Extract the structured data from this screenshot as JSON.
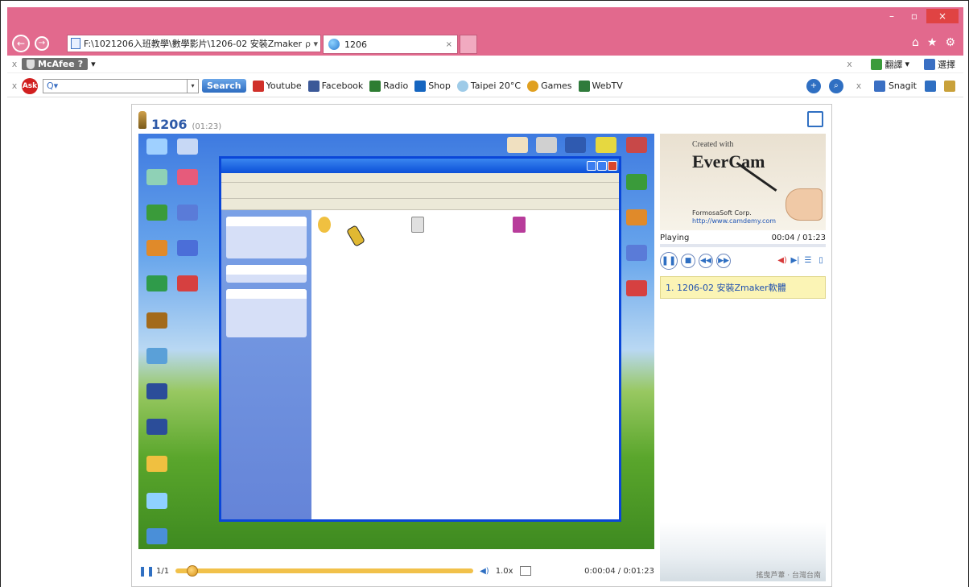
{
  "browser": {
    "address": "F:\\1021206入班教學\\數學影片\\1206-02 安裝Zmaker",
    "address_controls": "ρ ▾ C",
    "tab_title": "1206",
    "tab_close": "×",
    "win_min": "–",
    "win_max": "▫",
    "win_close": "×",
    "nav_back": "←",
    "nav_forward": "→",
    "home_icon": "⌂",
    "favorites_icon": "★",
    "settings_icon": "⚙"
  },
  "toolbar1": {
    "close": "x",
    "mcafee_label": "McAfee",
    "mcafee_help": "?",
    "mcafee_menu": "▾",
    "right_close": "x",
    "translate_label": "翻譯",
    "translate_menu": "▾",
    "select_label": "選擇"
  },
  "toolbar2": {
    "close": "x",
    "ask_label": "Ask",
    "search_placeholder": "Q▾",
    "dropdown": "▾",
    "search_button": "Search",
    "links": [
      {
        "label": "Youtube",
        "icon": "youtube-icon"
      },
      {
        "label": "Facebook",
        "icon": "facebook-icon"
      },
      {
        "label": "Radio",
        "icon": "radio-icon"
      },
      {
        "label": "Shop",
        "icon": "shop-icon"
      },
      {
        "label": "Taipei 20°C",
        "icon": "weather-icon"
      },
      {
        "label": "Games",
        "icon": "games-icon"
      },
      {
        "label": "WebTV",
        "icon": "tv-icon"
      }
    ],
    "right_close": "x",
    "snagit_label": "Snagit"
  },
  "player": {
    "title": "1206",
    "duration": "(01:23)",
    "page": "1/1",
    "speed": "1.0x",
    "time": "0:00:04 / 0:01:23",
    "pause_symbol": "❚❚",
    "volume_symbol": "◀)"
  },
  "sidebar": {
    "logo_created": "Created with",
    "logo_brand": "EverCam",
    "logo_corp": "FormosaSoft Corp.",
    "logo_url": "http://www.camdemy.com",
    "status": "Playing",
    "time": "00:04 / 01:23",
    "playlist_item": "1. 1206-02 安裝Zmaker軟體",
    "decor_caption": "搖曳芦葦 · 台灣台南",
    "ctl_pause": "❚❚",
    "ctl_stop": "■",
    "ctl_prev": "◀◀",
    "ctl_next": "▶▶",
    "ctl_volume": "◀)",
    "ctl_mark": "▶|",
    "ctl_list": "☰",
    "ctl_doc": "▯"
  },
  "colors": {
    "chrome": "#e2698d",
    "accent": "#2f6fc2",
    "xp_blue": "#0a46d8"
  }
}
